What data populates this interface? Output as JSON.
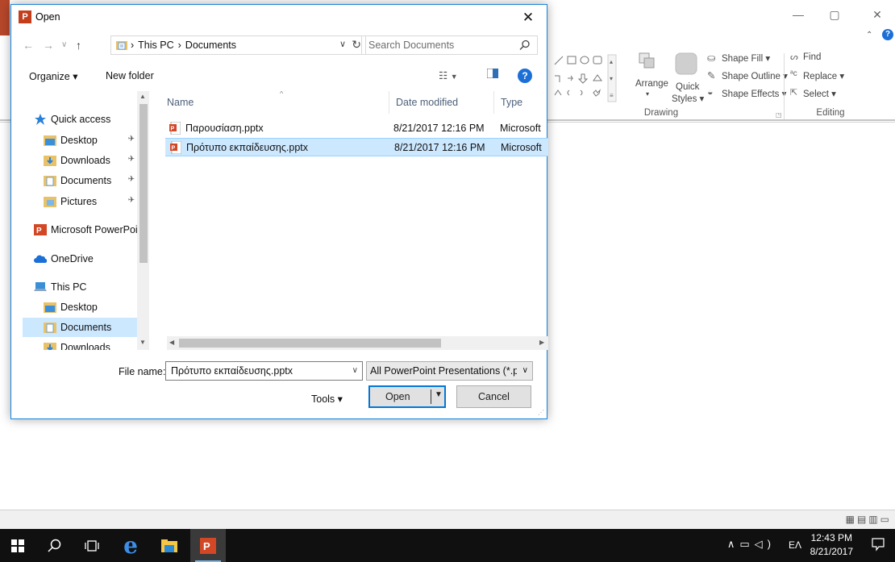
{
  "dialog": {
    "title": "Open",
    "app_icon_letter": "P",
    "close_glyph": "✕",
    "address": {
      "crumbs": [
        "›",
        "This PC",
        "›",
        "Documents"
      ]
    },
    "search": {
      "placeholder": "Search Documents"
    },
    "commands": {
      "organize": "Organize ▾",
      "new_folder": "New folder"
    },
    "nav_items": [
      {
        "label": "Quick access",
        "icon": "star-icon"
      },
      {
        "label": "Desktop",
        "icon": "folder-blue-icon"
      },
      {
        "label": "Downloads",
        "icon": "download-folder-icon"
      },
      {
        "label": "Documents",
        "icon": "documents-folder-icon"
      },
      {
        "label": "Pictures",
        "icon": "pictures-folder-icon"
      },
      {
        "label": "Microsoft PowerPoint",
        "icon": "powerpoint-icon"
      },
      {
        "label": "OneDrive",
        "icon": "cloud-icon"
      },
      {
        "label": "This PC",
        "icon": "computer-icon"
      },
      {
        "label": "Desktop",
        "icon": "folder-blue-icon"
      },
      {
        "label": "Documents",
        "icon": "documents-folder-icon"
      },
      {
        "label": "Downloads",
        "icon": "download-folder-icon"
      }
    ],
    "columns": {
      "name": "Name",
      "date": "Date modified",
      "type": "Type"
    },
    "files": [
      {
        "name": "Παρουσίαση.pptx",
        "date": "8/21/2017 12:16 PM",
        "type": "Microsoft"
      },
      {
        "name": "Πρότυπο εκπαίδευσης.pptx",
        "date": "8/21/2017 12:16 PM",
        "type": "Microsoft"
      }
    ],
    "file_name_label": "File name:",
    "file_name_value": "Πρότυπο εκπαίδευσης.pptx",
    "filter": "All PowerPoint Presentations (*.p",
    "tools_label": "Tools ▾",
    "open_label": "Open",
    "cancel_label": "Cancel"
  },
  "ribbon": {
    "shape_fill": "Shape Fill ▾",
    "shape_outline": "Shape Outline ▾",
    "shape_effects": "Shape Effects ▾",
    "arrange": "Arrange",
    "quick_styles_1": "Quick",
    "quick_styles_2": "Styles ▾",
    "find": "Find",
    "replace": "Replace ▾",
    "select": "Select ▾",
    "group_drawing": "Drawing",
    "group_editing": "Editing"
  },
  "taskbar": {
    "time": "12:43 PM",
    "date": "8/21/2017",
    "lang": "ΕΛ"
  },
  "colors": {
    "accent": "#0078d7",
    "selection": "#cce8ff",
    "taskbar": "#101010",
    "powerpoint": "#c43e1c"
  }
}
